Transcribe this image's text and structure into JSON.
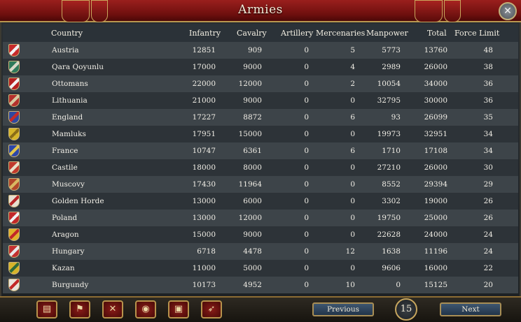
{
  "window": {
    "title": "Armies"
  },
  "columns": {
    "country": "Country",
    "infantry": "Infantry",
    "cavalry": "Cavalry",
    "artillery": "Artillery",
    "mercenaries": "Mercenaries",
    "manpower": "Manpower",
    "total": "Total",
    "force_limit": "Force Limit"
  },
  "rows": [
    {
      "country": "Austria",
      "infantry": "12851",
      "cavalry": "909",
      "artillery": "0",
      "mercenaries": "5",
      "manpower": "5773",
      "total": "13760",
      "force_limit": "48",
      "flag": [
        "#c62a2a",
        "#f2f2f2"
      ]
    },
    {
      "country": "Qara Qoyunlu",
      "infantry": "17000",
      "cavalry": "9000",
      "artillery": "0",
      "mercenaries": "4",
      "manpower": "2989",
      "total": "26000",
      "force_limit": "38",
      "flag": [
        "#2f7a5a",
        "#d8d8c8"
      ]
    },
    {
      "country": "Ottomans",
      "infantry": "22000",
      "cavalry": "12000",
      "artillery": "0",
      "mercenaries": "2",
      "manpower": "10054",
      "total": "34000",
      "force_limit": "36",
      "flag": [
        "#b52020",
        "#f2f2f2"
      ]
    },
    {
      "country": "Lithuania",
      "infantry": "21000",
      "cavalry": "9000",
      "artillery": "0",
      "mercenaries": "0",
      "manpower": "32795",
      "total": "30000",
      "force_limit": "36",
      "flag": [
        "#b3302c",
        "#d7c9a0"
      ]
    },
    {
      "country": "England",
      "infantry": "17227",
      "cavalry": "8872",
      "artillery": "0",
      "mercenaries": "6",
      "manpower": "93",
      "total": "26099",
      "force_limit": "35",
      "flag": [
        "#3049a0",
        "#c22a2a"
      ]
    },
    {
      "country": "Mamluks",
      "infantry": "17951",
      "cavalry": "15000",
      "artillery": "0",
      "mercenaries": "0",
      "manpower": "19973",
      "total": "32951",
      "force_limit": "34",
      "flag": [
        "#d6b62a",
        "#8a6d18"
      ]
    },
    {
      "country": "France",
      "infantry": "10747",
      "cavalry": "6361",
      "artillery": "0",
      "mercenaries": "6",
      "manpower": "1710",
      "total": "17108",
      "force_limit": "34",
      "flag": [
        "#2d47a8",
        "#e2c64c"
      ]
    },
    {
      "country": "Castile",
      "infantry": "18000",
      "cavalry": "8000",
      "artillery": "0",
      "mercenaries": "0",
      "manpower": "27210",
      "total": "26000",
      "force_limit": "30",
      "flag": [
        "#c03a2c",
        "#e8e0c8"
      ]
    },
    {
      "country": "Muscovy",
      "infantry": "17430",
      "cavalry": "11964",
      "artillery": "0",
      "mercenaries": "0",
      "manpower": "8552",
      "total": "29394",
      "force_limit": "29",
      "flag": [
        "#b0462a",
        "#d8b862"
      ]
    },
    {
      "country": "Golden Horde",
      "infantry": "13000",
      "cavalry": "6000",
      "artillery": "0",
      "mercenaries": "0",
      "manpower": "3302",
      "total": "19000",
      "force_limit": "26",
      "flag": [
        "#e6e0d0",
        "#b82828"
      ]
    },
    {
      "country": "Poland",
      "infantry": "13000",
      "cavalry": "12000",
      "artillery": "0",
      "mercenaries": "0",
      "manpower": "19750",
      "total": "25000",
      "force_limit": "26",
      "flag": [
        "#c22828",
        "#f0f0f0"
      ]
    },
    {
      "country": "Aragon",
      "infantry": "15000",
      "cavalry": "9000",
      "artillery": "0",
      "mercenaries": "0",
      "manpower": "22628",
      "total": "24000",
      "force_limit": "24",
      "flag": [
        "#e0b22a",
        "#c22828"
      ]
    },
    {
      "country": "Hungary",
      "infantry": "6718",
      "cavalry": "4478",
      "artillery": "0",
      "mercenaries": "12",
      "manpower": "1638",
      "total": "11196",
      "force_limit": "24",
      "flag": [
        "#c23030",
        "#e8e8e8"
      ]
    },
    {
      "country": "Kazan",
      "infantry": "11000",
      "cavalry": "5000",
      "artillery": "0",
      "mercenaries": "0",
      "manpower": "9606",
      "total": "16000",
      "force_limit": "22",
      "flag": [
        "#d6b42a",
        "#2f6a3a"
      ]
    },
    {
      "country": "Burgundy",
      "infantry": "10173",
      "cavalry": "4952",
      "artillery": "0",
      "mercenaries": "10",
      "manpower": "0",
      "total": "15125",
      "force_limit": "20",
      "flag": [
        "#e8e4dc",
        "#c22828"
      ]
    }
  ],
  "toolbar": {
    "buttons": [
      {
        "icon": "ledger-icon",
        "glyph": "▤"
      },
      {
        "icon": "flag-icon",
        "glyph": "⚑"
      },
      {
        "icon": "crossed-swords-icon",
        "glyph": "✕"
      },
      {
        "icon": "coins-icon",
        "glyph": "◉"
      },
      {
        "icon": "trade-goods-icon",
        "glyph": "▣"
      },
      {
        "icon": "cannon-icon",
        "glyph": "➶"
      }
    ]
  },
  "pagination": {
    "previous_label": "Previous",
    "next_label": "Next",
    "page": "15"
  },
  "colors": {
    "title_bar": "#7a1311",
    "gold_trim": "#b9974f",
    "row_odd": "#3d4449",
    "row_even": "#2d3338"
  }
}
